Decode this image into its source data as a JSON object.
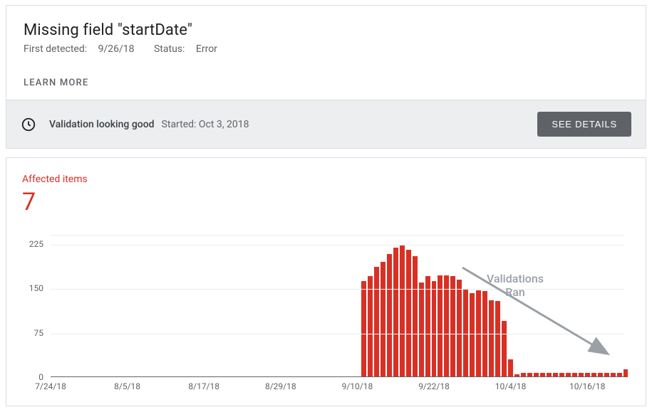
{
  "header": {
    "title": "Missing field \"startDate\"",
    "first_detected_label": "First detected:",
    "first_detected_value": "9/26/18",
    "status_label": "Status:",
    "status_value": "Error",
    "learn_more": "LEARN MORE"
  },
  "status_bar": {
    "icon": "clock-icon",
    "message": "Validation looking good",
    "started_label": "Started:",
    "started_value": "Oct 3, 2018",
    "button": "SEE DETAILS"
  },
  "chart": {
    "affected_label": "Affected items",
    "affected_count": "7"
  },
  "annotation": {
    "text_line1": "Validations",
    "text_line2": "Ran"
  },
  "chart_data": {
    "type": "bar",
    "title": "Affected items",
    "ylabel": "",
    "xlabel": "",
    "ylim": [
      0,
      240
    ],
    "y_ticks": [
      0,
      75,
      150,
      225
    ],
    "x_ticks": [
      "7/24/18",
      "8/5/18",
      "8/17/18",
      "8/29/18",
      "9/10/18",
      "9/22/18",
      "10/4/18",
      "10/16/18"
    ],
    "x_domain": [
      "7/24/18",
      "10/22/18"
    ],
    "annotation": "Validations Ran",
    "data": [
      {
        "date": "9/11/18",
        "value": 162
      },
      {
        "date": "9/12/18",
        "value": 170
      },
      {
        "date": "9/13/18",
        "value": 186
      },
      {
        "date": "9/14/18",
        "value": 195
      },
      {
        "date": "9/15/18",
        "value": 208
      },
      {
        "date": "9/16/18",
        "value": 218
      },
      {
        "date": "9/17/18",
        "value": 222
      },
      {
        "date": "9/18/18",
        "value": 215
      },
      {
        "date": "9/19/18",
        "value": 204
      },
      {
        "date": "9/20/18",
        "value": 160
      },
      {
        "date": "9/21/18",
        "value": 170
      },
      {
        "date": "9/22/18",
        "value": 162
      },
      {
        "date": "9/23/18",
        "value": 172
      },
      {
        "date": "9/24/18",
        "value": 172
      },
      {
        "date": "9/25/18",
        "value": 170
      },
      {
        "date": "9/26/18",
        "value": 164
      },
      {
        "date": "9/27/18",
        "value": 148
      },
      {
        "date": "9/28/18",
        "value": 142
      },
      {
        "date": "9/29/18",
        "value": 146
      },
      {
        "date": "9/30/18",
        "value": 145
      },
      {
        "date": "10/1/18",
        "value": 130
      },
      {
        "date": "10/2/18",
        "value": 128
      },
      {
        "date": "10/3/18",
        "value": 95
      },
      {
        "date": "10/4/18",
        "value": 30
      },
      {
        "date": "10/5/18",
        "value": 5
      },
      {
        "date": "10/6/18",
        "value": 7
      },
      {
        "date": "10/7/18",
        "value": 7
      },
      {
        "date": "10/8/18",
        "value": 7
      },
      {
        "date": "10/9/18",
        "value": 7
      },
      {
        "date": "10/10/18",
        "value": 7
      },
      {
        "date": "10/11/18",
        "value": 7
      },
      {
        "date": "10/12/18",
        "value": 7
      },
      {
        "date": "10/13/18",
        "value": 7
      },
      {
        "date": "10/14/18",
        "value": 7
      },
      {
        "date": "10/15/18",
        "value": 7
      },
      {
        "date": "10/16/18",
        "value": 7
      },
      {
        "date": "10/17/18",
        "value": 7
      },
      {
        "date": "10/18/18",
        "value": 7
      },
      {
        "date": "10/19/18",
        "value": 7
      },
      {
        "date": "10/20/18",
        "value": 7
      },
      {
        "date": "10/21/18",
        "value": 7
      },
      {
        "date": "10/22/18",
        "value": 13
      }
    ]
  }
}
